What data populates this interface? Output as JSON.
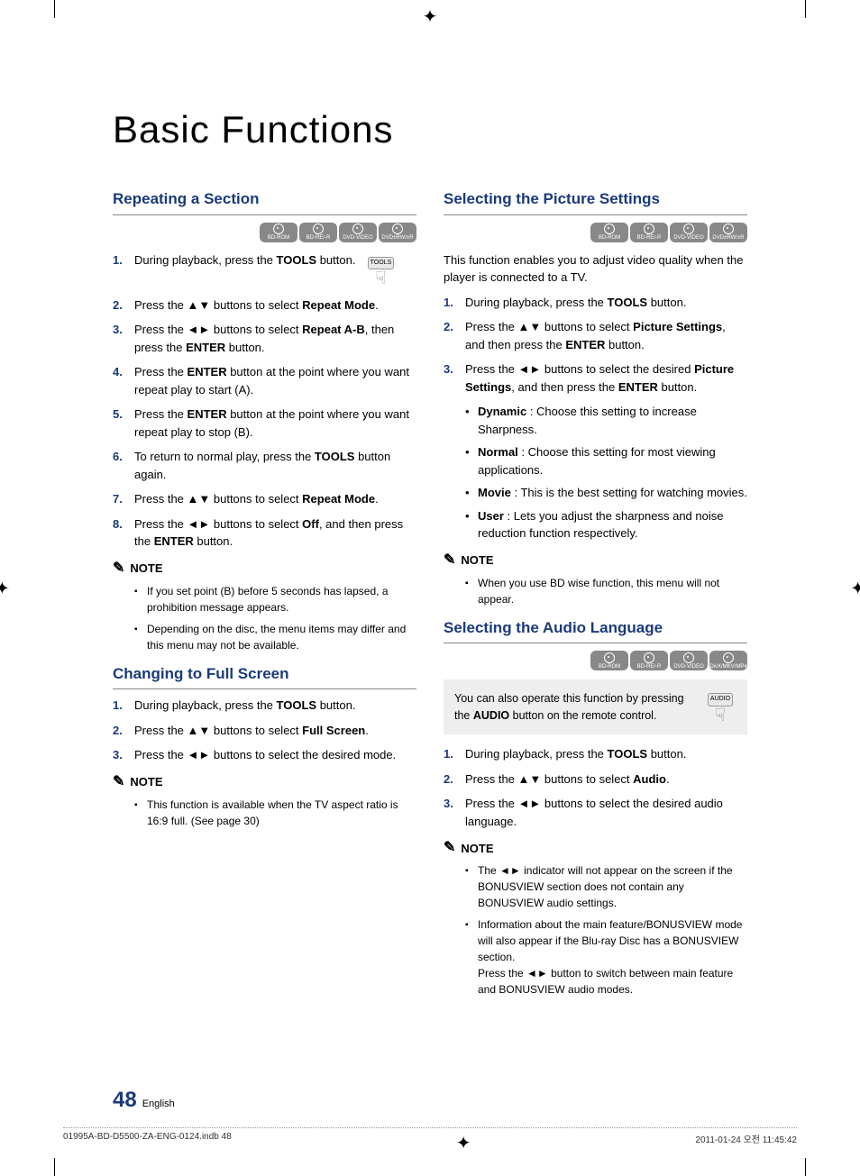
{
  "title": "Basic Functions",
  "badges": [
    "BD-ROM",
    "BD-RE/-R",
    "DVD-VIDEO",
    "DVD±RW/±R"
  ],
  "badges_audio": [
    "BD-ROM",
    "BD-RE/-R",
    "DVD-VIDEO",
    "DivX/MKV/MP4"
  ],
  "icons": {
    "tools": "TOOLS",
    "audio": "AUDIO"
  },
  "left": {
    "s1": {
      "title": "Repeating a Section",
      "steps": [
        {
          "n": "1.",
          "t": "During playback, press the <b>TOOLS</b> button."
        },
        {
          "n": "2.",
          "t": "Press the ▲▼ buttons to select <b>Repeat Mode</b>."
        },
        {
          "n": "3.",
          "t": "Press the ◄► buttons to select <b>Repeat A-B</b>, then press the <b>ENTER</b> button."
        },
        {
          "n": "4.",
          "t": "Press the <b>ENTER</b> button at the point where you want repeat play to start (A)."
        },
        {
          "n": "5.",
          "t": "Press the <b>ENTER</b> button at the point where you want repeat play to stop (B)."
        },
        {
          "n": "6.",
          "t": "To return to normal play, press the <b>TOOLS</b> button again."
        },
        {
          "n": "7.",
          "t": "Press the ▲▼ buttons to select <b>Repeat Mode</b>."
        },
        {
          "n": "8.",
          "t": "Press the ◄► buttons to select <b>Off</b>, and then press the <b>ENTER</b> button."
        }
      ],
      "note_label": "NOTE",
      "notes": [
        "If you set point (B) before 5 seconds has lapsed, a prohibition message appears.",
        "Depending on the disc, the menu items may differ and this menu may not be available."
      ]
    },
    "s2": {
      "title": "Changing to Full Screen",
      "steps": [
        {
          "n": "1.",
          "t": "During playback, press the <b>TOOLS</b> button."
        },
        {
          "n": "2.",
          "t": "Press the ▲▼ buttons to select <b>Full Screen</b>."
        },
        {
          "n": "3.",
          "t": "Press the ◄► buttons to select the desired mode."
        }
      ],
      "note_label": "NOTE",
      "notes": [
        "This function is available when the TV aspect ratio is 16:9 full. (See page 30)"
      ]
    }
  },
  "right": {
    "s1": {
      "title": "Selecting the Picture Settings",
      "intro": "This function enables you to adjust video quality when the player is connected to a TV.",
      "steps": [
        {
          "n": "1.",
          "t": "During playback, press the <b>TOOLS</b> button."
        },
        {
          "n": "2.",
          "t": "Press the ▲▼ buttons to select <b>Picture Settings</b>, and then press the <b>ENTER</b> button."
        },
        {
          "n": "3.",
          "t": "Press the ◄► buttons to select the desired <b>Picture Settings</b>, and then press the <b>ENTER</b> button."
        }
      ],
      "bullets": [
        "<b>Dynamic</b> : Choose this setting to increase Sharpness.",
        "<b>Normal</b> : Choose this setting for most viewing applications.",
        "<b>Movie</b> : This is the best setting for watching movies.",
        "<b>User</b> : Lets you adjust the sharpness and noise reduction function respectively."
      ],
      "note_label": "NOTE",
      "notes": [
        "When you use BD wise function, this menu will not appear."
      ]
    },
    "s2": {
      "title": "Selecting the Audio Language",
      "callout": "You can also operate this function by pressing the <b>AUDIO</b> button on the remote control.",
      "steps": [
        {
          "n": "1.",
          "t": "During playback, press the <b>TOOLS</b> button."
        },
        {
          "n": "2.",
          "t": "Press the ▲▼ buttons to select <b>Audio</b>."
        },
        {
          "n": "3.",
          "t": "Press the ◄► buttons to select the desired audio language."
        }
      ],
      "note_label": "NOTE",
      "notes": [
        "The ◄► indicator will not appear on the screen if the BONUSVIEW section does not contain any BONUSVIEW audio settings.",
        "Information about the main feature/BONUSVIEW mode will also appear if the Blu-ray Disc has a BONUSVIEW section.<br>Press the ◄► button to switch between main feature and BONUSVIEW audio modes."
      ]
    }
  },
  "footer": {
    "page": "48",
    "lang": "English"
  },
  "printline": {
    "left": "01995A-BD-D5500-ZA-ENG-0124.indb   48",
    "right": "2011-01-24   오전 11:45:42"
  }
}
